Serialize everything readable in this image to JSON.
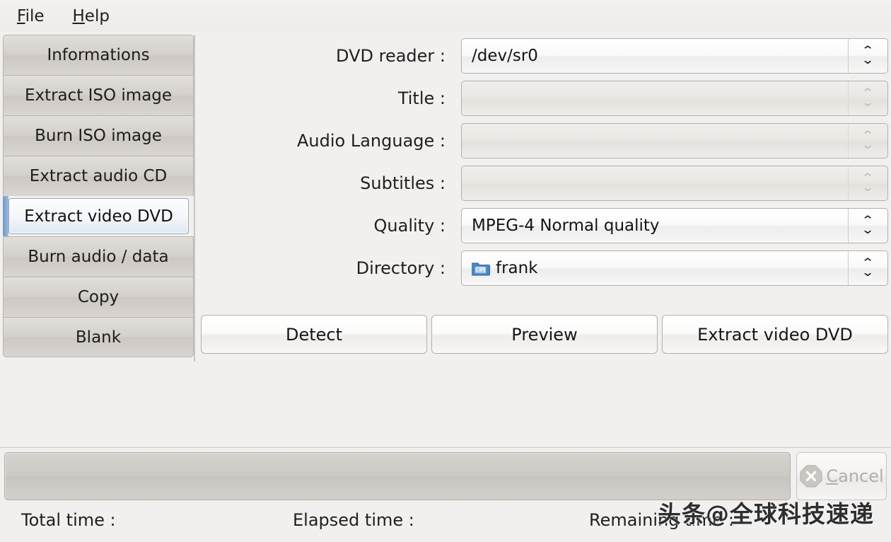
{
  "menubar": {
    "items": [
      {
        "label": "File",
        "mnemonic": "F",
        "rest": "ile"
      },
      {
        "label": "Help",
        "mnemonic": "H",
        "rest": "elp"
      }
    ]
  },
  "sidebar": {
    "items": [
      {
        "label": "Informations",
        "selected": false
      },
      {
        "label": "Extract ISO image",
        "selected": false
      },
      {
        "label": "Burn ISO image",
        "selected": false
      },
      {
        "label": "Extract audio CD",
        "selected": false
      },
      {
        "label": "Extract video DVD",
        "selected": true
      },
      {
        "label": "Burn audio / data",
        "selected": false
      },
      {
        "label": "Copy",
        "selected": false
      },
      {
        "label": "Blank",
        "selected": false
      }
    ],
    "selected_accent": "#6f9ac8"
  },
  "form": {
    "rows": [
      {
        "label": "DVD reader :",
        "value": "/dev/sr0",
        "disabled": false,
        "icon": ""
      },
      {
        "label": "Title :",
        "value": "",
        "disabled": true,
        "icon": ""
      },
      {
        "label": "Audio Language :",
        "value": "",
        "disabled": true,
        "icon": ""
      },
      {
        "label": "Subtitles :",
        "value": "",
        "disabled": true,
        "icon": ""
      },
      {
        "label": "Quality :",
        "value": "MPEG-4 Normal quality",
        "disabled": false,
        "icon": ""
      },
      {
        "label": "Directory :",
        "value": "frank",
        "disabled": false,
        "icon": "folder-icon"
      }
    ]
  },
  "actions": {
    "buttons": [
      {
        "label": "Detect"
      },
      {
        "label": "Preview"
      },
      {
        "label": "Extract video DVD"
      }
    ]
  },
  "status": {
    "progress_percent": 0,
    "cancel": {
      "label": "Cancel",
      "mnemonic": "C",
      "rest": "ancel",
      "icon": "close-x-icon",
      "disabled": true
    },
    "total_time_label": "Total time :",
    "total_time_value": "",
    "elapsed_time_label": "Elapsed time :",
    "elapsed_time_value": "",
    "remaining_time_label": "Remaining time :",
    "remaining_time_value": ""
  },
  "watermark": {
    "text": "头条@全球科技速递"
  }
}
